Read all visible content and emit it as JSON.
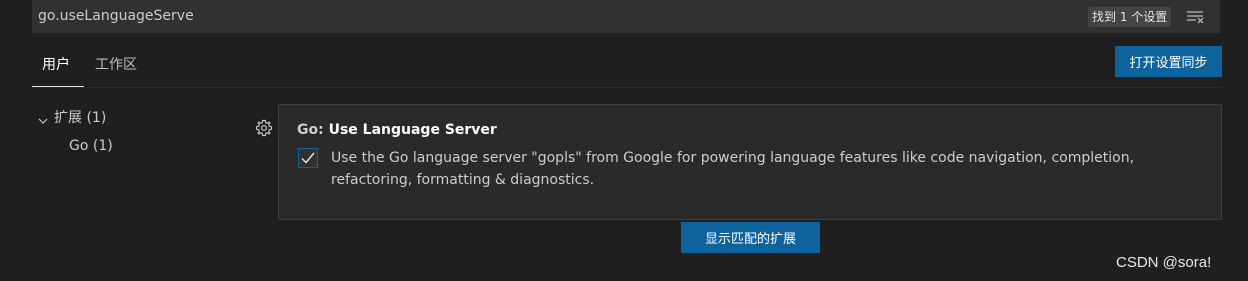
{
  "search": {
    "value": "go.useLanguageServe",
    "result_count": "找到 1 个设置",
    "clear_filter_icon": "clear-filter-icon"
  },
  "tabs": [
    {
      "label": "用户",
      "active": true
    },
    {
      "label": "工作区",
      "active": false
    }
  ],
  "sync_button_label": "打开设置同步",
  "tree": {
    "group_label": "扩展 (1)",
    "expanded": true,
    "children": [
      {
        "label": "Go (1)"
      }
    ]
  },
  "setting": {
    "category": "Go: ",
    "name": "Use Language Server",
    "checked": true,
    "description": "Use the Go language server \"gopls\" from Google for powering language features like code navigation, completion, refactoring, formatting & diagnostics.",
    "gear_icon": "gear-icon"
  },
  "show_extensions_button_label": "显示匹配的扩展",
  "watermark": "CSDN @sora!",
  "colors": {
    "background": "#1f1f1f",
    "accent": "#0e639c",
    "card": "#2a2a2a"
  }
}
